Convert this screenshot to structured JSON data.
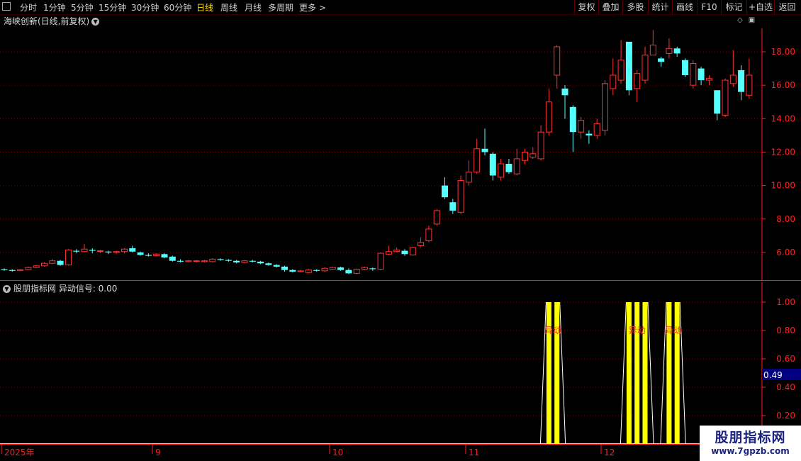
{
  "toolbar": {
    "tabs": [
      "分时",
      "1分钟",
      "5分钟",
      "15分钟",
      "30分钟",
      "60分钟",
      "日线",
      "周线",
      "月线",
      "多周期",
      "更多 >"
    ],
    "active_tab": "日线",
    "right_buttons": [
      "复权",
      "叠加",
      "多股",
      "统计",
      "画线",
      "F10",
      "标记",
      "+自选",
      "返回"
    ]
  },
  "title": "海峡创新(日线,前复权)",
  "indicator": {
    "title": "股朋指标网 异动信号: 0.00",
    "signal_label": "异动",
    "value_box": "0.49"
  },
  "watermark": {
    "line1": "股朋指标网",
    "line2": "www.7gpzb.com"
  },
  "colors": {
    "up": "#ff3232",
    "down": "#54ffff",
    "signal": "#ffff00",
    "grid": "#7a0000",
    "axis": "#ff2020"
  },
  "x_axis_labels": [
    "2025年",
    "9",
    "10",
    "11",
    "12"
  ],
  "chart_data": [
    {
      "type": "candlestick",
      "ylim": [
        4.3,
        19.4
      ],
      "yticks": [
        6.0,
        8.0,
        10.0,
        12.0,
        14.0,
        16.0,
        18.0
      ],
      "candles": [
        [
          5.0,
          4.95,
          5.05,
          4.9
        ],
        [
          4.95,
          4.9,
          5.0,
          4.85
        ],
        [
          4.92,
          4.98,
          5.02,
          4.88
        ],
        [
          4.98,
          5.1,
          5.15,
          4.95
        ],
        [
          5.1,
          5.2,
          5.25,
          5.05
        ],
        [
          5.2,
          5.35,
          5.4,
          5.15
        ],
        [
          5.35,
          5.5,
          5.6,
          5.3
        ],
        [
          5.5,
          5.25,
          5.55,
          5.2
        ],
        [
          5.25,
          6.15,
          6.2,
          5.2
        ],
        [
          6.1,
          6.05,
          6.2,
          5.95
        ],
        [
          6.05,
          6.2,
          6.5,
          6.0
        ],
        [
          6.15,
          6.1,
          6.25,
          5.95
        ],
        [
          6.1,
          6.1,
          6.15,
          5.95
        ],
        [
          6.05,
          6.0,
          6.1,
          5.9
        ],
        [
          6.0,
          6.05,
          6.1,
          5.9
        ],
        [
          6.05,
          6.2,
          6.25,
          5.95
        ],
        [
          6.25,
          6.05,
          6.4,
          6.0
        ],
        [
          6.0,
          5.85,
          6.05,
          5.8
        ],
        [
          5.85,
          5.8,
          5.95,
          5.75
        ],
        [
          5.8,
          5.9,
          5.95,
          5.75
        ],
        [
          5.9,
          5.7,
          5.95,
          5.65
        ],
        [
          5.75,
          5.5,
          5.8,
          5.45
        ],
        [
          5.5,
          5.45,
          5.6,
          5.4
        ],
        [
          5.45,
          5.5,
          5.55,
          5.4
        ],
        [
          5.5,
          5.5,
          5.55,
          5.4
        ],
        [
          5.45,
          5.5,
          5.55,
          5.4
        ],
        [
          5.45,
          5.6,
          5.65,
          5.4
        ],
        [
          5.6,
          5.55,
          5.65,
          5.5
        ],
        [
          5.55,
          5.5,
          5.6,
          5.45
        ],
        [
          5.5,
          5.4,
          5.55,
          5.35
        ],
        [
          5.4,
          5.5,
          5.55,
          5.35
        ],
        [
          5.5,
          5.45,
          5.55,
          5.4
        ],
        [
          5.45,
          5.35,
          5.5,
          5.3
        ],
        [
          5.35,
          5.25,
          5.4,
          5.2
        ],
        [
          5.25,
          5.15,
          5.3,
          5.1
        ],
        [
          5.15,
          4.95,
          5.2,
          4.85
        ],
        [
          4.95,
          4.85,
          5.0,
          4.8
        ],
        [
          4.85,
          4.9,
          4.95,
          4.8
        ],
        [
          4.8,
          4.95,
          5.0,
          4.75
        ],
        [
          4.95,
          4.9,
          5.0,
          4.85
        ],
        [
          4.9,
          5.05,
          5.1,
          4.85
        ],
        [
          5.0,
          5.1,
          5.15,
          4.95
        ],
        [
          5.1,
          4.95,
          5.15,
          4.9
        ],
        [
          4.95,
          4.75,
          5.05,
          4.7
        ],
        [
          4.75,
          5.0,
          5.05,
          4.7
        ],
        [
          5.0,
          5.1,
          5.15,
          4.95
        ],
        [
          5.05,
          5.0,
          5.1,
          4.9
        ],
        [
          5.0,
          5.95,
          6.0,
          4.95
        ],
        [
          5.9,
          6.05,
          6.4,
          5.85
        ],
        [
          6.05,
          6.15,
          6.3,
          6.0
        ],
        [
          6.1,
          5.9,
          6.2,
          5.8
        ],
        [
          5.85,
          6.3,
          6.35,
          5.8
        ],
        [
          6.4,
          6.6,
          6.9,
          6.3
        ],
        [
          6.7,
          7.4,
          7.6,
          6.6
        ],
        [
          7.7,
          8.5,
          8.6,
          7.6
        ],
        [
          10.0,
          9.3,
          10.5,
          9.2
        ],
        [
          9.0,
          8.5,
          9.2,
          8.3
        ],
        [
          8.4,
          10.3,
          10.6,
          8.3
        ],
        [
          10.2,
          10.8,
          11.5,
          10.0
        ],
        [
          10.8,
          12.2,
          12.8,
          10.7
        ],
        [
          12.2,
          12.0,
          13.4,
          11.8
        ],
        [
          11.9,
          10.6,
          12.0,
          10.3
        ],
        [
          10.5,
          11.3,
          11.6,
          10.3
        ],
        [
          11.3,
          10.8,
          11.6,
          10.7
        ],
        [
          10.7,
          11.6,
          12.2,
          10.6
        ],
        [
          11.5,
          12.0,
          12.2,
          11.3
        ],
        [
          11.7,
          11.9,
          12.3,
          11.6
        ],
        [
          11.6,
          13.2,
          13.6,
          11.5
        ],
        [
          13.2,
          15.0,
          15.8,
          13.0
        ],
        [
          16.6,
          18.3,
          18.4,
          15.8
        ],
        [
          15.8,
          15.4,
          16.0,
          14.0
        ],
        [
          14.7,
          13.2,
          14.8,
          12.0
        ],
        [
          13.2,
          13.9,
          14.1,
          12.8
        ],
        [
          13.1,
          13.0,
          13.3,
          12.5
        ],
        [
          13.0,
          13.7,
          14.0,
          12.8
        ],
        [
          13.3,
          16.1,
          16.3,
          13.0
        ],
        [
          15.8,
          16.6,
          17.6,
          15.4
        ],
        [
          16.3,
          17.5,
          18.7,
          16.1
        ],
        [
          18.6,
          15.7,
          18.6,
          15.4
        ],
        [
          15.8,
          16.7,
          16.9,
          15.0
        ],
        [
          16.3,
          17.8,
          18.3,
          16.1
        ],
        [
          17.8,
          18.4,
          19.3,
          17.8
        ],
        [
          17.6,
          17.4,
          17.7,
          17.1
        ],
        [
          17.9,
          18.2,
          18.8,
          17.6
        ],
        [
          18.2,
          17.9,
          18.3,
          17.7
        ],
        [
          17.5,
          16.6,
          17.6,
          16.5
        ],
        [
          16.0,
          17.3,
          17.5,
          15.8
        ],
        [
          17.0,
          16.3,
          17.1,
          16.0
        ],
        [
          16.3,
          16.4,
          16.6,
          16.0
        ],
        [
          15.7,
          14.3,
          15.7,
          13.9
        ],
        [
          14.2,
          16.3,
          16.4,
          14.1
        ],
        [
          16.1,
          16.6,
          18.1,
          15.9
        ],
        [
          16.9,
          15.6,
          17.2,
          15.1
        ],
        [
          15.4,
          16.6,
          17.6,
          15.2
        ]
      ]
    },
    {
      "type": "bar",
      "ylim": [
        0.0,
        1.05
      ],
      "yticks": [
        0.2,
        0.4,
        0.6,
        0.8,
        1.0
      ],
      "signal_bars": [
        68,
        69,
        78,
        79,
        80,
        83,
        84
      ]
    }
  ]
}
